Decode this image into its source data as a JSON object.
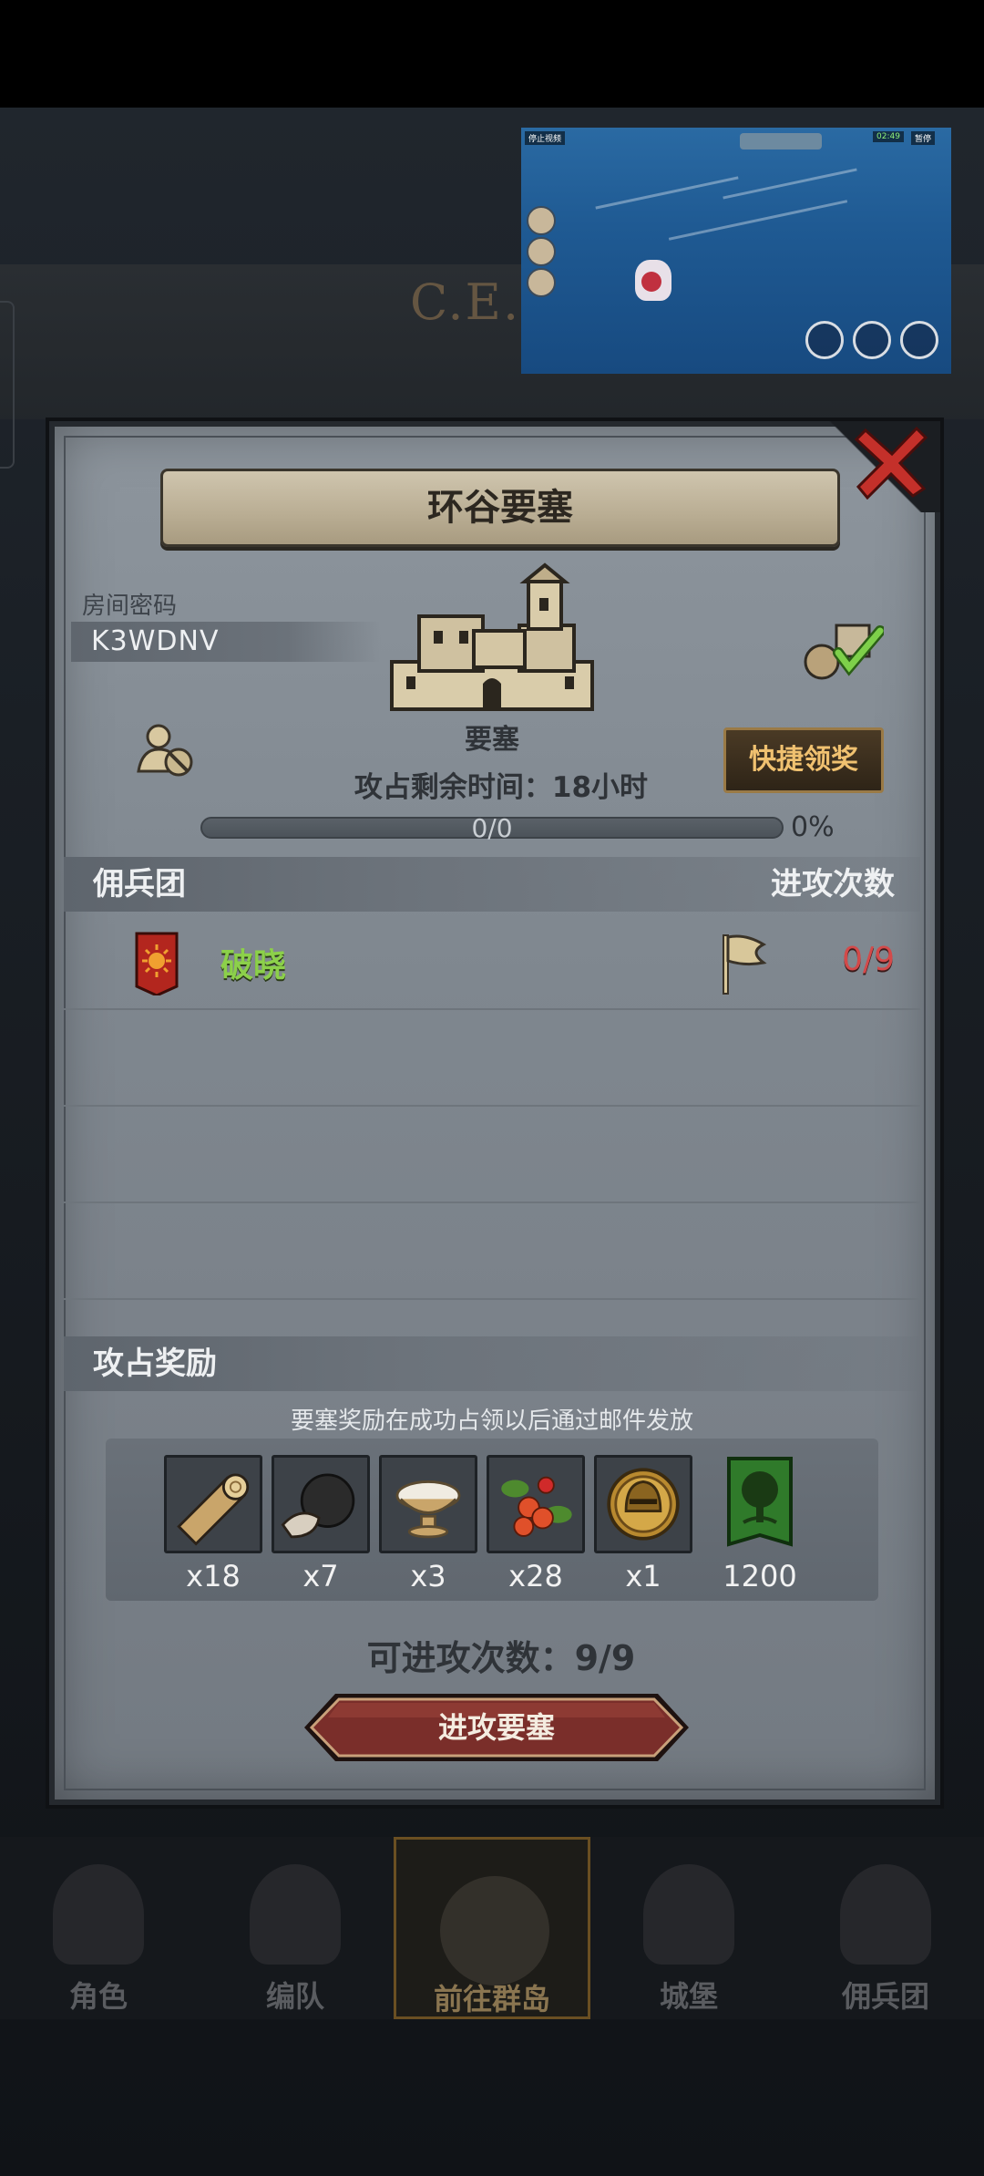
{
  "background": {
    "ce_text": "C.E.1C",
    "nav": [
      {
        "label": "角色",
        "icon": "knight-icon",
        "active": false
      },
      {
        "label": "编队",
        "icon": "helmet-icon",
        "active": false
      },
      {
        "label": "前往群岛",
        "icon": "compass-icon",
        "active": true
      },
      {
        "label": "城堡",
        "icon": "castle-icon",
        "active": false
      },
      {
        "label": "佣兵团",
        "icon": "mercenary-icon",
        "active": false
      }
    ]
  },
  "video_overlay": {
    "chip_left": "停止视频",
    "chip_score": "02:49",
    "chip_pause": "暂停"
  },
  "dialog": {
    "title": "环谷要塞",
    "room_code_label": "房间密码",
    "room_code": "K3WDNV",
    "fortress_type": "要塞",
    "remaining_time": "攻占剩余时间：18小时",
    "progress_text": "0/0",
    "progress_percent": "0%",
    "progress_fraction": 0,
    "quick_claim": "快捷领奖",
    "mercenary_header": "佣兵团",
    "attack_times_header": "进攻次数",
    "mercenaries": [
      {
        "name": "破晓",
        "attacks": "0/9"
      }
    ],
    "reward_header": "攻占奖励",
    "reward_note": "要塞奖励在成功占领以后通过邮件发放",
    "rewards": [
      {
        "name": "wood-log-icon",
        "qty": "x18",
        "bg": "#3d4248"
      },
      {
        "name": "truffle-icon",
        "qty": "x7",
        "bg": "#3d4248"
      },
      {
        "name": "bowl-icon",
        "qty": "x3",
        "bg": "#3d4248"
      },
      {
        "name": "berries-icon",
        "qty": "x28",
        "bg": "#3d4248"
      },
      {
        "name": "knight-helmet-medal-icon",
        "qty": "x1",
        "bg": "#3d4248"
      },
      {
        "name": "tree-banner-icon",
        "qty": "1200",
        "bg": "#2f5a24"
      }
    ],
    "attacks_available": "可进攻次数：9/9",
    "attack_button": "进攻要塞"
  },
  "colors": {
    "accent_green": "#8cd04a",
    "accent_red": "#d34a4a",
    "quick_btn_text": "#f0c170",
    "attack_btn": "#7a2e2a"
  }
}
